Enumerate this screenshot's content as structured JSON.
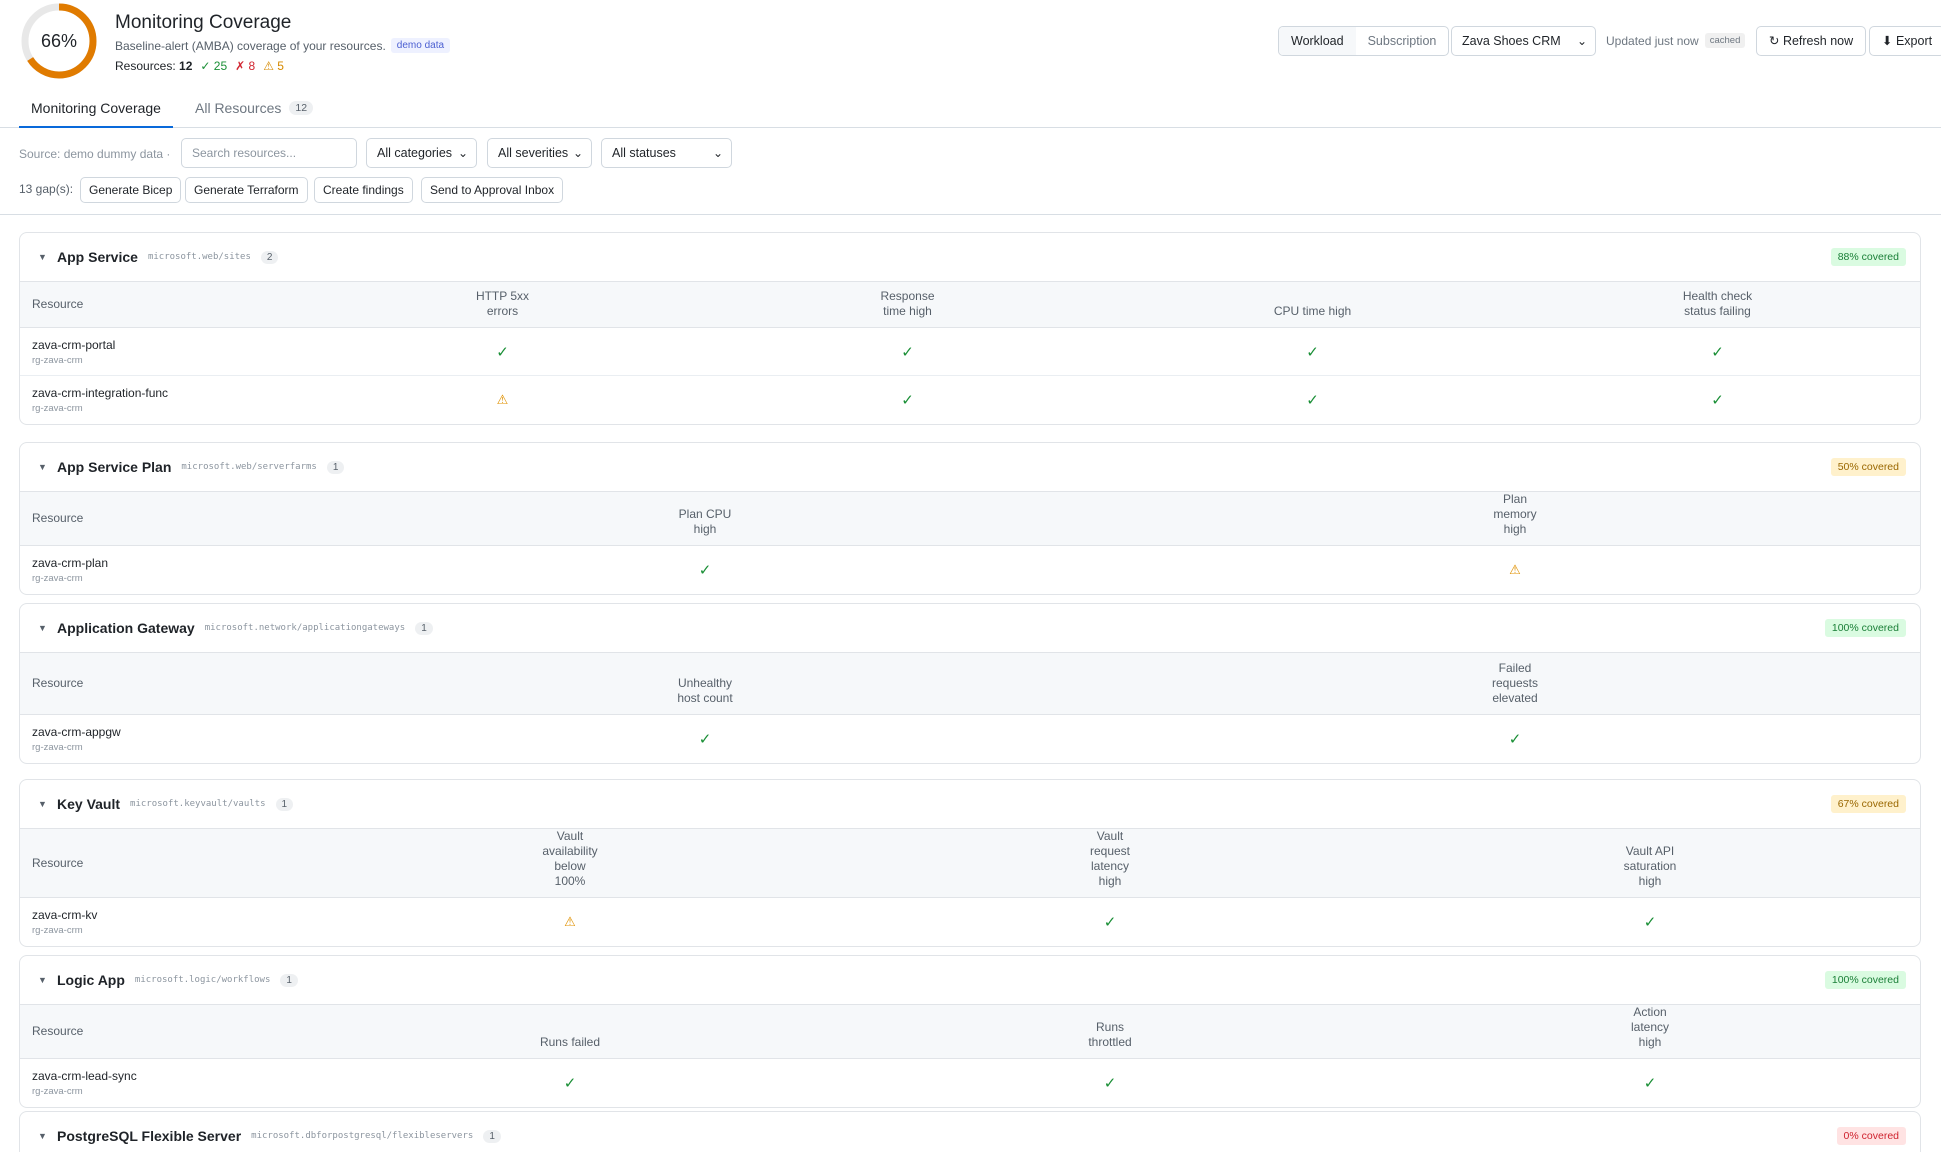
{
  "header": {
    "coverage_percent": 66,
    "coverage_label": "66%",
    "title": "Monitoring Coverage",
    "subtitle": "Baseline-alert (AMBA) coverage of your resources.",
    "demo_badge": "demo data",
    "resources_label": "Resources:",
    "resources_count": "12",
    "ok_count": "✓ 25",
    "missing_count": "✗ 8",
    "warn_count": "⚠ 5",
    "scope_options": [
      "Workload",
      "Subscription"
    ],
    "scope_selected": "Workload",
    "workload_selected": "Zava Shoes CRM",
    "updated_text": "Updated just now",
    "cached_badge": "cached",
    "refresh_label": "↻ Refresh now",
    "export_label": "⬇ Export"
  },
  "tabs": [
    {
      "label": "Monitoring Coverage",
      "count": ""
    },
    {
      "label": "All Resources",
      "count": "12"
    }
  ],
  "filters": {
    "source_text": "Source: demo dummy data ·",
    "search_placeholder": "Search resources...",
    "categories": "All categories",
    "severities": "All severities",
    "statuses": "All statuses",
    "gaps_text": "13 gap(s):",
    "actions": [
      "Generate Bicep",
      "Generate Terraform",
      "Create findings",
      "Send to Approval Inbox"
    ]
  },
  "status_glyphs": {
    "ok": "✓",
    "warn": "⚠",
    "missing": "✗"
  },
  "colors": {
    "ok": "#1a8f36",
    "warn": "#e09100",
    "missing": "#d1242f",
    "accent": "#0969da",
    "ring": "#e07b00"
  },
  "resource_column_label": "Resource",
  "sections": [
    {
      "title": "App Service",
      "type": "microsoft.web/sites",
      "count": "2",
      "coverage": "88% covered",
      "tone": "green",
      "metrics": [
        "HTTP 5xx errors",
        "Response time high",
        "CPU time high",
        "Health check status failing"
      ],
      "rows": [
        {
          "name": "zava-crm-portal",
          "group": "rg-zava-crm",
          "statuses": [
            "ok",
            "ok",
            "ok",
            "ok"
          ]
        },
        {
          "name": "zava-crm-integration-func",
          "group": "rg-zava-crm",
          "statuses": [
            "warn",
            "ok",
            "ok",
            "ok"
          ]
        }
      ]
    },
    {
      "title": "App Service Plan",
      "type": "microsoft.web/serverfarms",
      "count": "1",
      "coverage": "50% covered",
      "tone": "amber",
      "metrics": [
        "Plan CPU high",
        "Plan memory high"
      ],
      "rows": [
        {
          "name": "zava-crm-plan",
          "group": "rg-zava-crm",
          "statuses": [
            "ok",
            "warn"
          ]
        }
      ]
    },
    {
      "title": "Application Gateway",
      "type": "microsoft.network/applicationgateways",
      "count": "1",
      "coverage": "100% covered",
      "tone": "green",
      "metrics": [
        "Unhealthy host count",
        "Failed requests elevated"
      ],
      "rows": [
        {
          "name": "zava-crm-appgw",
          "group": "rg-zava-crm",
          "statuses": [
            "ok",
            "ok"
          ]
        }
      ]
    },
    {
      "title": "Key Vault",
      "type": "microsoft.keyvault/vaults",
      "count": "1",
      "coverage": "67% covered",
      "tone": "amber",
      "metrics": [
        "Vault availability below 100%",
        "Vault request latency high",
        "Vault API saturation high"
      ],
      "rows": [
        {
          "name": "zava-crm-kv",
          "group": "rg-zava-crm",
          "statuses": [
            "warn",
            "ok",
            "ok"
          ]
        }
      ]
    },
    {
      "title": "Logic App",
      "type": "microsoft.logic/workflows",
      "count": "1",
      "coverage": "100% covered",
      "tone": "green",
      "metrics": [
        "Runs failed",
        "Runs throttled",
        "Action latency high"
      ],
      "rows": [
        {
          "name": "zava-crm-lead-sync",
          "group": "rg-zava-crm",
          "statuses": [
            "ok",
            "ok",
            "ok"
          ]
        }
      ]
    },
    {
      "title": "PostgreSQL Flexible Server",
      "type": "microsoft.dbforpostgresql/flexibleservers",
      "count": "1",
      "coverage": "0% covered",
      "tone": "red",
      "metrics": [],
      "rows": []
    }
  ]
}
